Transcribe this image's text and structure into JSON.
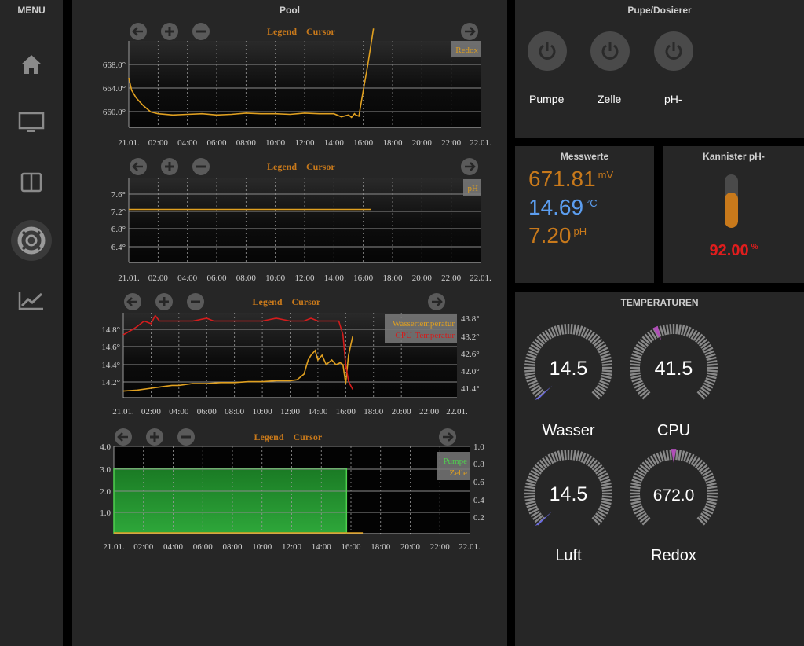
{
  "menu": {
    "title": "MENU",
    "items": [
      {
        "icon": "home-icon"
      },
      {
        "icon": "monitor-icon"
      },
      {
        "icon": "columns-icon"
      },
      {
        "icon": "lifebuoy-icon"
      },
      {
        "icon": "chart-line-icon"
      }
    ]
  },
  "pool": {
    "title": "Pool",
    "legend_label": "Legend",
    "cursor_label": "Cursor",
    "x_ticks": [
      "21.01.",
      "02:00",
      "04:00",
      "06:00",
      "08:00",
      "10:00",
      "12:00",
      "14:00",
      "16:00",
      "18:00",
      "20:00",
      "22:00",
      "22.01."
    ]
  },
  "pumpe": {
    "title": "Pupe/Dosierer",
    "buttons": [
      {
        "label": "Pumpe"
      },
      {
        "label": "Zelle"
      },
      {
        "label": "pH-"
      }
    ]
  },
  "messwerte": {
    "title": "Messwerte",
    "values": [
      {
        "value": "671.81",
        "unit": "mV",
        "color": "#c8791b"
      },
      {
        "value": "14.69",
        "unit": "°C",
        "color": "#5c9ef0"
      },
      {
        "value": "7.20",
        "unit": "pH",
        "color": "#c8791b"
      }
    ]
  },
  "kannister": {
    "title": "Kannister pH-",
    "value": "92.00",
    "unit": "%",
    "fill_fraction": 0.92,
    "color": "#e01d1d"
  },
  "temperaturen": {
    "title": "TEMPERATUREN",
    "gauges": [
      {
        "name": "Wasser",
        "value": "14.5",
        "fraction": 0.0,
        "needle_color": "#6a6ae6"
      },
      {
        "name": "CPU",
        "value": "41.5",
        "fraction": 0.41,
        "needle_color": "#b04fb8"
      },
      {
        "name": "Luft",
        "value": "14.5",
        "fraction": 0.0,
        "needle_color": "#6a6ae6"
      },
      {
        "name": "Redox",
        "value": "672.0",
        "fraction": 0.5,
        "needle_color": "#b04fb8"
      }
    ]
  },
  "chart_data": [
    {
      "type": "line",
      "y_ticks": [
        "668.0°",
        "664.0°",
        "660.0°"
      ],
      "ylim": [
        657,
        671
      ],
      "legend": [
        "Redox"
      ],
      "line_color": "#e0a020",
      "series": [
        {
          "name": "Redox",
          "x": [
            0,
            0.2,
            0.5,
            0.8,
            1,
            1.5,
            2,
            3,
            4,
            5,
            6,
            7,
            8,
            9,
            10,
            11,
            12,
            13,
            14,
            14.5,
            15,
            15.2,
            15.4,
            15.5,
            15.7,
            16,
            16.3,
            16.7
          ],
          "y": [
            665,
            663,
            661.8,
            661,
            660.5,
            659.5,
            659.2,
            659,
            659.1,
            659.2,
            659,
            659.1,
            659.3,
            659.2,
            659.2,
            659.1,
            659.3,
            659.2,
            659.2,
            658.7,
            659,
            658.6,
            659.2,
            659,
            658.8,
            663,
            667,
            673
          ]
        }
      ]
    },
    {
      "type": "line",
      "y_ticks": [
        "7.6°",
        "7.2°",
        "6.8°",
        "6.4°"
      ],
      "ylim": [
        6.2,
        7.8
      ],
      "legend": [
        "pH"
      ],
      "line_color": "#e0a020",
      "series": [
        {
          "name": "pH",
          "x": [
            0,
            16.5
          ],
          "y": [
            7.2,
            7.2
          ]
        }
      ]
    },
    {
      "type": "line",
      "y_ticks": [
        "14.8°",
        "14.6°",
        "14.4°",
        "14.2°"
      ],
      "y2_ticks": [
        "43.8°",
        "43.2°",
        "42.6°",
        "42.0°",
        "41.4°"
      ],
      "ylim": [
        14.05,
        14.95
      ],
      "y2lim": [
        41.0,
        44.1
      ],
      "legend": [
        "Wassertemperatur",
        "CPU-Temperatur"
      ],
      "series": [
        {
          "name": "Wassertemperatur",
          "color": "#e0a020",
          "x": [
            0,
            1,
            2,
            3,
            3.5,
            4,
            5,
            6,
            7,
            8,
            9,
            10,
            11,
            12,
            12.5,
            13,
            13.3,
            13.5,
            13.8,
            14,
            14.3,
            14.6,
            15,
            15.3,
            15.6,
            15.8,
            16,
            16.2,
            16.5
          ],
          "y": [
            14.12,
            14.13,
            14.15,
            14.17,
            14.18,
            14.18,
            14.2,
            14.2,
            14.21,
            14.21,
            14.22,
            14.22,
            14.23,
            14.23,
            14.24,
            14.3,
            14.45,
            14.5,
            14.55,
            14.45,
            14.5,
            14.4,
            14.45,
            14.4,
            14.42,
            14.4,
            14.2,
            14.5,
            14.7
          ]
        },
        {
          "name": "CPU-Temperatur",
          "color": "#d41c1c",
          "x": [
            0,
            0.7,
            1,
            1.5,
            2,
            2.3,
            2.6,
            3,
            4,
            5,
            6,
            6.5,
            7,
            8,
            9,
            10,
            11,
            12,
            13,
            13.5,
            14,
            14.5,
            15,
            15.5,
            15.8,
            16,
            16.2,
            16.5
          ],
          "y": [
            43.3,
            43.5,
            43.6,
            43.8,
            43.7,
            44.0,
            43.8,
            43.8,
            43.8,
            43.8,
            43.9,
            43.8,
            43.8,
            43.8,
            43.8,
            43.8,
            43.9,
            43.8,
            43.8,
            43.9,
            43.8,
            43.8,
            43.8,
            43.8,
            43.3,
            42.2,
            41.6,
            41.3
          ]
        }
      ]
    },
    {
      "type": "area",
      "y_ticks": [
        "4.0",
        "3.0",
        "2.0",
        "1.0"
      ],
      "y2_ticks": [
        "1.0",
        "0.8",
        "0.6",
        "0.4",
        "0.2"
      ],
      "ylim": [
        0,
        4
      ],
      "y2lim": [
        0,
        1
      ],
      "legend": [
        "Pumpe",
        "Zelle"
      ],
      "series": [
        {
          "name": "Pumpe",
          "color": "#4fd04f",
          "x": [
            0,
            15.7,
            15.7
          ],
          "y": [
            3,
            3,
            0
          ]
        },
        {
          "name": "Zelle",
          "color": "#e0a020",
          "x": [
            0,
            16.8
          ],
          "y": [
            0,
            0
          ]
        }
      ]
    }
  ]
}
